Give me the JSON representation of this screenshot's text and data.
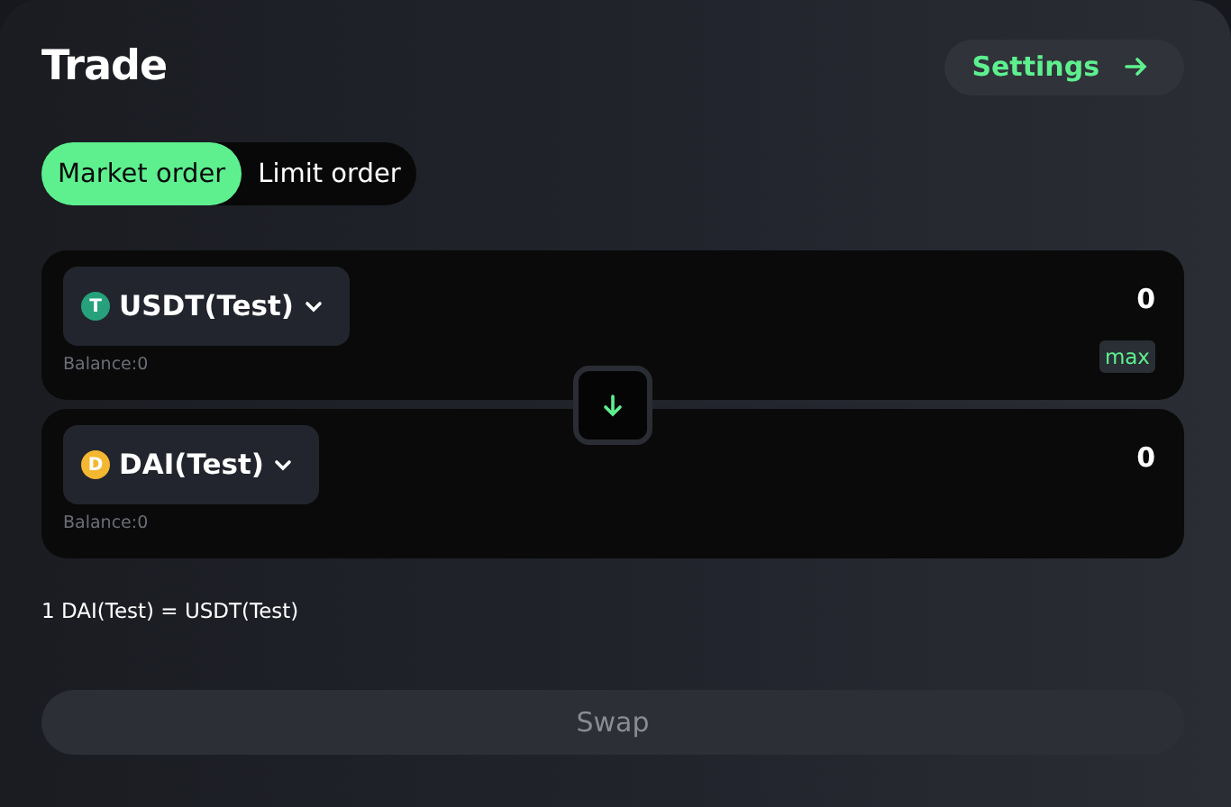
{
  "header": {
    "title": "Trade",
    "settings_button": {
      "label": "Settings"
    }
  },
  "order_tabs": [
    {
      "label": "Market order",
      "selected": true
    },
    {
      "label": "Limit order",
      "selected": false
    }
  ],
  "panels": [
    {
      "token": "USDT(Test)",
      "icon_letter": "T",
      "color": "#26a17b",
      "balance": "Balance:0",
      "amount": "0",
      "max_label": "max"
    },
    {
      "token": "DAI(Test)",
      "icon_letter": "D",
      "color": "#f4b731",
      "balance": "Balance:0",
      "amount": "0"
    }
  ],
  "rate": "1 DAI(Test) = USDT(Test)",
  "swap_button": {
    "label": "Swap",
    "disabled": true
  }
}
